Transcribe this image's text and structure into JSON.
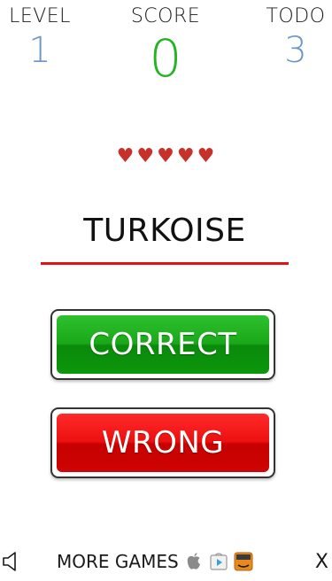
{
  "hud": {
    "level_label": "LEVEL",
    "level_value": "1",
    "score_label": "SCORE",
    "score_value": "0",
    "todo_label": "TODO",
    "todo_value": "3"
  },
  "lives": {
    "count": 5,
    "icon": "heart-icon",
    "color": "#c8302a"
  },
  "word": {
    "text": "TURKOISE",
    "underline_color": "#e51212"
  },
  "buttons": {
    "correct_label": "CORRECT",
    "correct_color": "#18a818",
    "wrong_label": "WRONG",
    "wrong_color": "#ec1010"
  },
  "footer": {
    "sound_icon": "speaker-icon",
    "more_games_label": "MORE GAMES",
    "store_icons": [
      "apple-icon",
      "google-play-icon",
      "amazon-icon"
    ],
    "close_label": "X"
  }
}
